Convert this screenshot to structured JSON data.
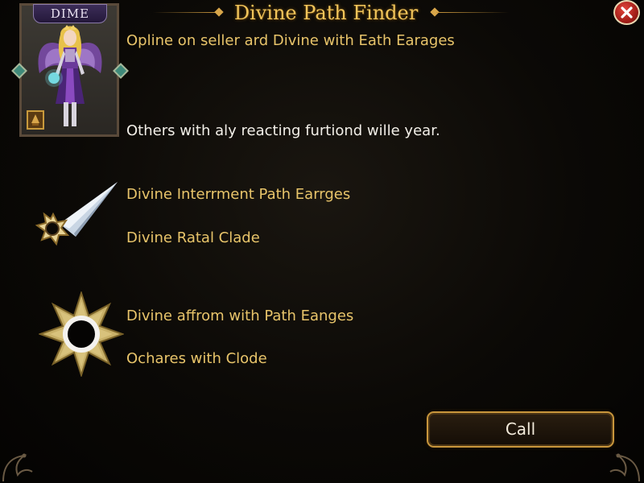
{
  "dialog": {
    "title": "Divine Path Finder",
    "close_icon": "close-icon"
  },
  "portrait": {
    "label": "DIME",
    "icon": "hero-portrait"
  },
  "lines": {
    "subtitle": "Opline on seller ard Divine with Eath Earages",
    "description": "Others with aly reacting furtiond wille year.",
    "item1_name": "Divine Interrment Path Earrges",
    "item1_detail": "Divine Ratal Clade",
    "item2_name": "Divine affrom with Path Eanges",
    "item2_detail": "Ochares with Clode"
  },
  "items": [
    {
      "icon": "dagger-icon"
    },
    {
      "icon": "star-ring-icon"
    }
  ],
  "actions": {
    "call_label": "Call"
  },
  "colors": {
    "title": "#f0c45a",
    "accent_gold": "#e8c46a",
    "body_text": "#f2efe8",
    "button_border": "#c8963c",
    "close_red": "#c02a22"
  }
}
